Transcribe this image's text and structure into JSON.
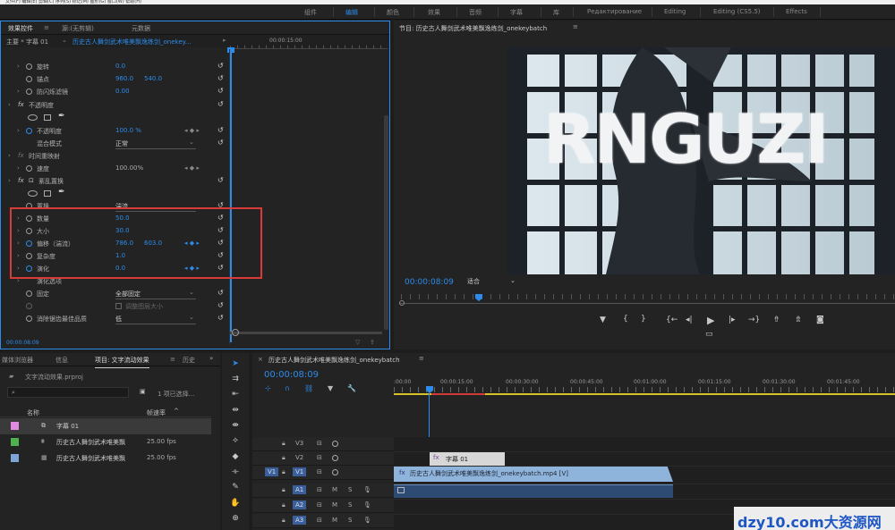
{
  "menubar": {
    "text": "文件(F)  编辑(E)  剪辑(C)  序列(S)  标记(M)  图形(G)  窗口(W)  帮助(H)"
  },
  "workspaces": [
    "组件",
    "编辑",
    "颜色",
    "效果",
    "音频",
    "字幕",
    "库",
    "Редактирование",
    "Editing",
    "Editing (CS5.5)",
    "Effects"
  ],
  "effect_controls": {
    "tabs": [
      "效果控件",
      "源:(无剪辑)",
      "元数据"
    ],
    "clip_master": "主要 * 字幕 01",
    "clip_sequence": "历史古人舞剑武术唯美飘逸练剑_onekey...",
    "ruler_time": "00:00:15:00",
    "rows": [
      {
        "label": "旋转",
        "v1": "0.0"
      },
      {
        "label": "锚点",
        "v1": "960.0",
        "v2": "540.0"
      },
      {
        "label": "防闪烁滤镜",
        "v1": "0.00"
      },
      {
        "label": "不透明度"
      },
      {
        "label": "不透明度",
        "v1": "100.0 %"
      },
      {
        "label": "混合模式",
        "v1": "正常"
      },
      {
        "label": "时间重映射"
      },
      {
        "label": "速度",
        "v1": "100.00%"
      },
      {
        "label": "紊乱置换"
      },
      {
        "label": "置换",
        "v1": "湍流"
      },
      {
        "label": "数量",
        "v1": "50.0"
      },
      {
        "label": "大小",
        "v1": "30.0"
      },
      {
        "label": "偏移（湍流）",
        "v1": "786.0",
        "v2": "603.0"
      },
      {
        "label": "复杂度",
        "v1": "1.0"
      },
      {
        "label": "演化",
        "v1": "0.0"
      },
      {
        "label": "演化选项"
      },
      {
        "label": "固定",
        "v1": "全部固定"
      },
      {
        "label": "调整图层大小"
      },
      {
        "label": "消除锯齿最佳品质",
        "v1": "低"
      }
    ],
    "timecode": "00:00:08:09",
    "fx_label": "fx"
  },
  "program_monitor": {
    "title": "节目: 历史古人舞剑武术唯美飘逸练剑_onekeybatch",
    "overlay_text": "RNGUZI",
    "timecode": "00:00:08:09",
    "fit": "适合"
  },
  "project": {
    "tabs": [
      "媒体浏览器",
      "信息",
      "项目: 文字流动效果",
      "历史"
    ],
    "file": "文字流动效果.prproj",
    "selection": "1 项已选择...",
    "col_name": "名称",
    "col_rate": "帧速率",
    "items": [
      {
        "name": "字幕 01",
        "rate": "",
        "color": "#e08be0"
      },
      {
        "name": "历史古人舞剑武术唯美飘",
        "rate": "25.00 fps",
        "color": "#4fb04f"
      },
      {
        "name": "历史古人舞剑武术唯美飘",
        "rate": "25.00 fps",
        "color": "#7fa4d8"
      }
    ]
  },
  "timeline": {
    "tab": "历史古人舞剑武术唯美飘逸练剑_onekeybatch",
    "timecode": "00:00:08:09",
    "ruler": [
      ":00:00",
      "00:00:15:00",
      "00:00:30:00",
      "00:00:45:00",
      "00:01:00:00",
      "00:01:15:00",
      "00:01:30:00",
      "00:01:45:00"
    ],
    "tracks": [
      "V3",
      "V2",
      "V1",
      "A1",
      "A2",
      "A3"
    ],
    "source_patch": "V1",
    "title_clip": "字幕 01",
    "video_clip": "历史古人舞剑武术唯美飘逸练剑_onekeybatch.mp4 [V]"
  },
  "watermark": "dzy10.com大资源网"
}
